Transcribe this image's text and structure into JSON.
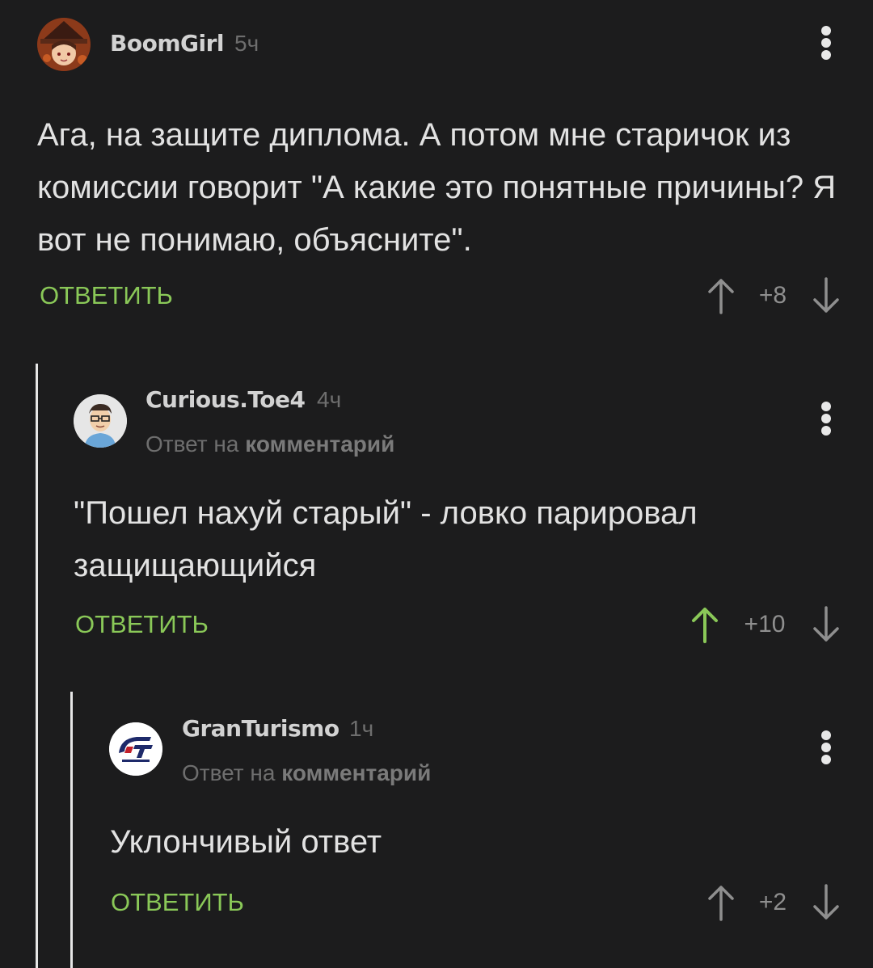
{
  "comments": [
    {
      "username": "BoomGirl",
      "time": "5ч",
      "reply_to": null,
      "text": "Ага, на защите диплома. А потом мне старичок из комиссии говорит \"А какие это понятные причины? Я вот не понимаю, объясните\".",
      "reply_label": "ОТВЕТИТЬ",
      "rating": "+8",
      "upvoted": false
    },
    {
      "username": "Curious.Toe4",
      "time": "4ч",
      "reply_to": {
        "prefix": "Ответ на",
        "link": "комментарий"
      },
      "text": "\"Пошел нахуй старый\" - ловко парировал защищающийся",
      "reply_label": "ОТВЕТИТЬ",
      "rating": "+10",
      "upvoted": true
    },
    {
      "username": "GranTurismo",
      "time": "1ч",
      "reply_to": {
        "prefix": "Ответ на",
        "link": "комментарий"
      },
      "text": "Уклончивый ответ",
      "reply_label": "ОТВЕТИТЬ",
      "rating": "+2",
      "upvoted": false
    }
  ],
  "colors": {
    "background": "#1c1c1d",
    "accent_green": "#8ac858",
    "text": "#e2e2e2",
    "muted": "#6e6e6e"
  },
  "icons": {
    "menu": "more-vertical-icon",
    "upvote": "arrow-up-icon",
    "downvote": "arrow-down-icon"
  }
}
